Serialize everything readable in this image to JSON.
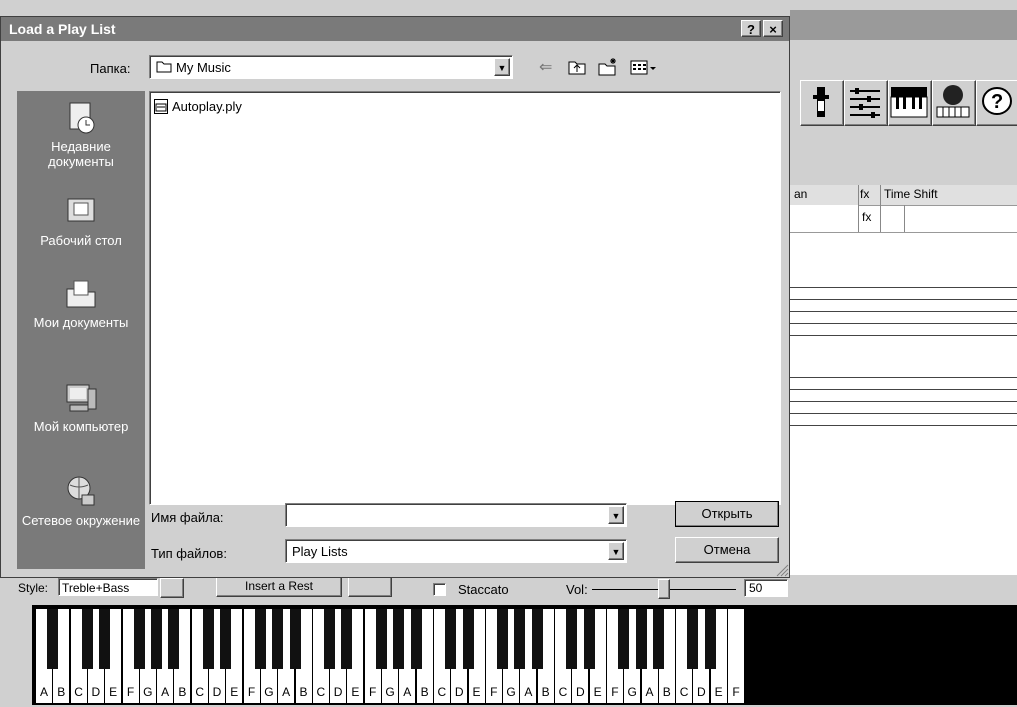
{
  "dialog": {
    "title": "Load a Play List",
    "help": "?",
    "close": "×",
    "folder_label": "Папка:",
    "folder_value": "My Music",
    "places": [
      {
        "label": "Недавние документы",
        "icon": "recent-documents-icon"
      },
      {
        "label": "Рабочий стол",
        "icon": "desktop-icon"
      },
      {
        "label": "Мои документы",
        "icon": "my-documents-icon"
      },
      {
        "label": "Мой компьютер",
        "icon": "my-computer-icon"
      },
      {
        "label": "Сетевое окружение",
        "icon": "network-icon"
      }
    ],
    "files": [
      {
        "name": "Autoplay.ply",
        "icon": "playlist-file-icon"
      }
    ],
    "filename_label": "Имя файла:",
    "filename_value": "",
    "filetype_label": "Тип файлов:",
    "filetype_value": "Play Lists",
    "open_button": "Открыть",
    "cancel_button": "Отмена"
  },
  "background": {
    "grid_headers": [
      "an",
      "fx",
      "Time Shift"
    ],
    "grid_cell": "fx",
    "style_label": "Style:",
    "style_value": "Treble+Bass",
    "insert_rest": "Insert a Rest",
    "staccato": "Staccato",
    "vol_label": "Vol:",
    "vol_value": "50",
    "keys": [
      "A",
      "B",
      "C",
      "D",
      "E",
      "F",
      "G",
      "A",
      "B",
      "C",
      "D",
      "E",
      "F",
      "G",
      "A",
      "B",
      "C",
      "D",
      "E",
      "F",
      "G",
      "A",
      "B",
      "C",
      "D",
      "E",
      "F",
      "G",
      "A",
      "B",
      "C",
      "D",
      "E",
      "F",
      "G",
      "A",
      "B",
      "C",
      "D",
      "E",
      "F"
    ]
  }
}
